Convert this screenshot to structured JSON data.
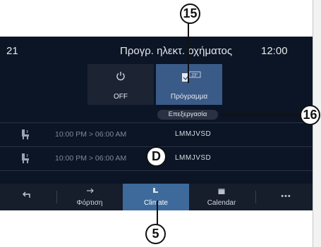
{
  "header": {
    "left_value": "21",
    "title": "Προγρ. ηλεκτ. οχήματος",
    "time": "12:00"
  },
  "modes": [
    {
      "label": "OFF",
      "icon": "power-icon"
    },
    {
      "label": "Πρόγραμμα",
      "icon": "schedule-program-icon",
      "badge": "23°"
    }
  ],
  "edit_label": "Επεξεργασία",
  "schedules": [
    {
      "time": "10:00 PM > 06:00 AM",
      "days": "LMMJVSD"
    },
    {
      "time": "10:00 PM > 06:00 AM",
      "days": "LMMJVSD"
    }
  ],
  "tabs": [
    {
      "label": "",
      "icon": "back-arrow-icon"
    },
    {
      "label": "Φόρτιση",
      "icon": "charging-icon"
    },
    {
      "label": "Climate",
      "icon": "climate-icon",
      "active": true
    },
    {
      "label": "Calendar",
      "icon": "calendar-icon"
    },
    {
      "label": "",
      "icon": "more-icon",
      "glyph": "•••"
    }
  ],
  "callouts": {
    "c15": "15",
    "c16": "16",
    "cD": "D",
    "c5": "5"
  },
  "colors": {
    "screen_bg": "#0b1526",
    "active_tile": "#3a5a88",
    "active_tab": "#3d6a9a"
  }
}
